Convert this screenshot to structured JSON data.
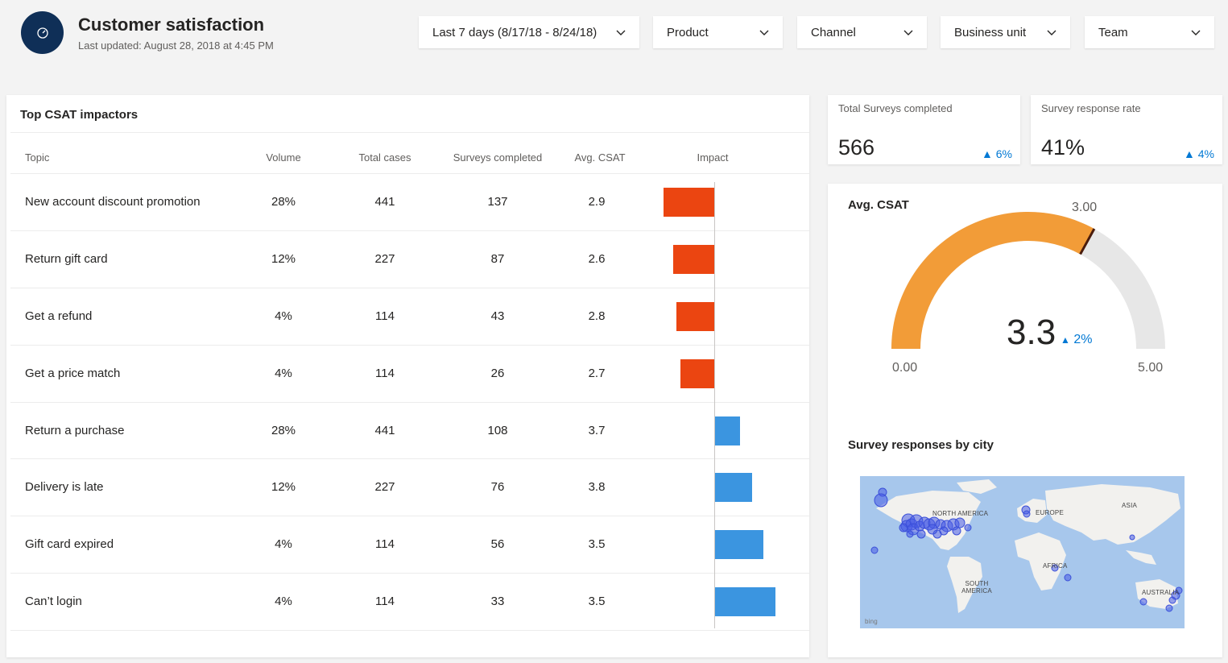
{
  "header": {
    "title": "Customer satisfaction",
    "updated": "Last updated: August 28, 2018 at 4:45 PM",
    "icon": "gauge-icon"
  },
  "filters": [
    {
      "label": "Last 7 days (8/17/18 - 8/24/18)"
    },
    {
      "label": "Product"
    },
    {
      "label": "Channel"
    },
    {
      "label": "Business unit"
    },
    {
      "label": "Team"
    }
  ],
  "impactors": {
    "title": "Top CSAT impactors",
    "columns": [
      "Topic",
      "Volume",
      "Total cases",
      "Surveys completed",
      "Avg. CSAT",
      "Impact"
    ],
    "rows": [
      {
        "topic": "New account discount promotion",
        "volume": "28%",
        "cases": "441",
        "surveys": "137",
        "csat": "2.9",
        "impact": -1.0
      },
      {
        "topic": "Return gift card",
        "volume": "12%",
        "cases": "227",
        "surveys": "87",
        "csat": "2.6",
        "impact": -0.81
      },
      {
        "topic": "Get a refund",
        "volume": "4%",
        "cases": "114",
        "surveys": "43",
        "csat": "2.8",
        "impact": -0.74
      },
      {
        "topic": "Get a price match",
        "volume": "4%",
        "cases": "114",
        "surveys": "26",
        "csat": "2.7",
        "impact": -0.67
      },
      {
        "topic": "Return a purchase",
        "volume": "28%",
        "cases": "441",
        "surveys": "108",
        "csat": "3.7",
        "impact": 0.49
      },
      {
        "topic": "Delivery is late",
        "volume": "12%",
        "cases": "227",
        "surveys": "76",
        "csat": "3.8",
        "impact": 0.73
      },
      {
        "topic": "Gift card expired",
        "volume": "4%",
        "cases": "114",
        "surveys": "56",
        "csat": "3.5",
        "impact": 0.95
      },
      {
        "topic": "Can’t login",
        "volume": "4%",
        "cases": "114",
        "surveys": "33",
        "csat": "3.5",
        "impact": 1.19
      }
    ]
  },
  "kpis": [
    {
      "label": "Total Surveys completed",
      "value": "566",
      "delta": "6%"
    },
    {
      "label": "Survey response rate",
      "value": "41%",
      "delta": "4%"
    }
  ],
  "gauge": {
    "title": "Avg. CSAT",
    "min_label": "0.00",
    "max_label": "5.00",
    "target_label": "3.00",
    "value_label": "3.3",
    "delta": "2%",
    "min": 0,
    "max": 5,
    "value": 3.3,
    "target": 3.0
  },
  "map": {
    "title": "Survey responses by city",
    "labels": [
      "NORTH AMERICA",
      "EUROPE",
      "ASIA",
      "AFRICA",
      "SOUTH AMERICA",
      "AUSTRALIA"
    ],
    "attribution": "bing"
  },
  "colors": {
    "negative": "#eb4511",
    "positive": "#3b95e0",
    "gauge_fill": "#f29c38",
    "gauge_track": "#e7e7e7",
    "gauge_target": "#4a1c0c",
    "header_icon": "#0f2f57",
    "delta": "#0078d4"
  }
}
